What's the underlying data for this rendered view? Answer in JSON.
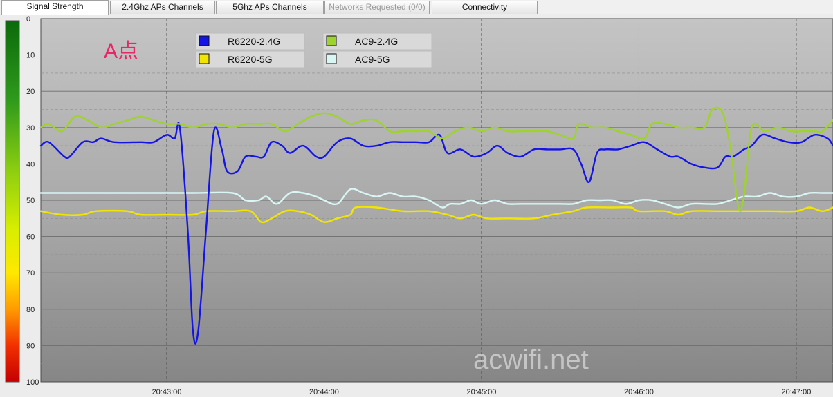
{
  "tabs": [
    {
      "label": "Signal Strength",
      "active": true,
      "enabled": true
    },
    {
      "label": "2.4Ghz APs Channels",
      "active": false,
      "enabled": true
    },
    {
      "label": "5Ghz APs Channels",
      "active": false,
      "enabled": true
    },
    {
      "label": "Networks Requested (0/0)",
      "active": false,
      "enabled": false
    },
    {
      "label": "Connectivity",
      "active": false,
      "enabled": true
    }
  ],
  "annotation": {
    "text": "A点",
    "color": "#e8266a"
  },
  "watermark": "acwifi.net",
  "chart_data": {
    "type": "line",
    "y_axis": {
      "range": [
        0,
        100
      ],
      "inverted": true,
      "ticks": [
        0,
        10,
        20,
        30,
        40,
        50,
        60,
        70,
        80,
        90,
        100
      ]
    },
    "x_axis": {
      "range": [
        "20:42:12",
        "20:47:14"
      ],
      "ticks": [
        "20:43:00",
        "20:44:00",
        "20:45:00",
        "20:46:00",
        "20:47:00"
      ]
    },
    "grid": true,
    "legend_placement": "top-left",
    "series": [
      {
        "name": "R6220-2.4G",
        "color": "#1414e6",
        "points": [
          [
            "20:42:12",
            35
          ],
          [
            "20:42:15",
            34
          ],
          [
            "20:42:21",
            38
          ],
          [
            "20:42:23",
            38
          ],
          [
            "20:42:28",
            34
          ],
          [
            "20:42:32",
            34
          ],
          [
            "20:42:35",
            33
          ],
          [
            "20:42:40",
            34
          ],
          [
            "20:42:50",
            34
          ],
          [
            "20:42:55",
            34
          ],
          [
            "20:43:00",
            32
          ],
          [
            "20:43:03",
            33
          ],
          [
            "20:43:05",
            30
          ],
          [
            "20:43:08",
            58
          ],
          [
            "20:43:10",
            86
          ],
          [
            "20:43:12",
            86
          ],
          [
            "20:43:15",
            58
          ],
          [
            "20:43:18",
            31
          ],
          [
            "20:43:21",
            36
          ],
          [
            "20:43:23",
            42
          ],
          [
            "20:43:27",
            42
          ],
          [
            "20:43:30",
            38
          ],
          [
            "20:43:34",
            38
          ],
          [
            "20:43:37",
            38
          ],
          [
            "20:43:40",
            34
          ],
          [
            "20:43:44",
            35
          ],
          [
            "20:43:47",
            37
          ],
          [
            "20:43:52",
            35
          ],
          [
            "20:43:57",
            38
          ],
          [
            "20:44:00",
            38
          ],
          [
            "20:44:05",
            34
          ],
          [
            "20:44:10",
            33
          ],
          [
            "20:44:15",
            35
          ],
          [
            "20:44:20",
            35
          ],
          [
            "20:44:25",
            34
          ],
          [
            "20:44:30",
            34
          ],
          [
            "20:44:35",
            34
          ],
          [
            "20:44:40",
            34
          ],
          [
            "20:44:44",
            32
          ],
          [
            "20:44:47",
            37
          ],
          [
            "20:44:52",
            36
          ],
          [
            "20:44:57",
            38
          ],
          [
            "20:45:02",
            37
          ],
          [
            "20:45:06",
            35
          ],
          [
            "20:45:10",
            37
          ],
          [
            "20:45:15",
            38
          ],
          [
            "20:45:20",
            36
          ],
          [
            "20:45:25",
            36
          ],
          [
            "20:45:30",
            36
          ],
          [
            "20:45:35",
            36
          ],
          [
            "20:45:38",
            40
          ],
          [
            "20:45:41",
            45
          ],
          [
            "20:45:44",
            37
          ],
          [
            "20:45:47",
            36
          ],
          [
            "20:45:52",
            36
          ],
          [
            "20:45:57",
            35
          ],
          [
            "20:46:02",
            34
          ],
          [
            "20:46:07",
            36
          ],
          [
            "20:46:12",
            38
          ],
          [
            "20:46:15",
            38
          ],
          [
            "20:46:20",
            40
          ],
          [
            "20:46:25",
            41
          ],
          [
            "20:46:30",
            41
          ],
          [
            "20:46:33",
            38
          ],
          [
            "20:46:36",
            38
          ],
          [
            "20:46:40",
            36
          ],
          [
            "20:46:43",
            35
          ],
          [
            "20:46:47",
            32
          ],
          [
            "20:46:52",
            33
          ],
          [
            "20:46:57",
            34
          ],
          [
            "20:47:02",
            34
          ],
          [
            "20:47:07",
            32
          ],
          [
            "20:47:12",
            33
          ],
          [
            "20:47:14",
            35
          ]
        ]
      },
      {
        "name": "R6220-5G",
        "color": "#f2e600",
        "points": [
          [
            "20:42:12",
            53
          ],
          [
            "20:42:20",
            54
          ],
          [
            "20:42:28",
            54
          ],
          [
            "20:42:33",
            53
          ],
          [
            "20:42:45",
            53
          ],
          [
            "20:42:50",
            54
          ],
          [
            "20:43:00",
            54
          ],
          [
            "20:43:10",
            54
          ],
          [
            "20:43:15",
            53
          ],
          [
            "20:43:25",
            53
          ],
          [
            "20:43:32",
            53
          ],
          [
            "20:43:36",
            56
          ],
          [
            "20:43:40",
            55
          ],
          [
            "20:43:45",
            53
          ],
          [
            "20:43:50",
            53
          ],
          [
            "20:43:55",
            54
          ],
          [
            "20:44:00",
            56
          ],
          [
            "20:44:05",
            55
          ],
          [
            "20:44:10",
            54
          ],
          [
            "20:44:12",
            52
          ],
          [
            "20:44:20",
            52
          ],
          [
            "20:44:30",
            53
          ],
          [
            "20:44:40",
            53
          ],
          [
            "20:44:47",
            54
          ],
          [
            "20:44:52",
            55
          ],
          [
            "20:44:57",
            54
          ],
          [
            "20:45:02",
            55
          ],
          [
            "20:45:10",
            55
          ],
          [
            "20:45:20",
            55
          ],
          [
            "20:45:27",
            54
          ],
          [
            "20:45:35",
            53
          ],
          [
            "20:45:40",
            52
          ],
          [
            "20:45:50",
            52
          ],
          [
            "20:45:57",
            52
          ],
          [
            "20:46:00",
            53
          ],
          [
            "20:46:10",
            53
          ],
          [
            "20:46:15",
            54
          ],
          [
            "20:46:20",
            53
          ],
          [
            "20:46:30",
            53
          ],
          [
            "20:46:40",
            53
          ],
          [
            "20:46:50",
            53
          ],
          [
            "20:47:00",
            53
          ],
          [
            "20:47:05",
            52
          ],
          [
            "20:47:10",
            53
          ],
          [
            "20:47:14",
            52
          ]
        ]
      },
      {
        "name": "AC9-2.4G",
        "color": "#9ed22c",
        "points": [
          [
            "20:42:12",
            30
          ],
          [
            "20:42:15",
            29
          ],
          [
            "20:42:20",
            31
          ],
          [
            "20:42:25",
            27
          ],
          [
            "20:42:30",
            28
          ],
          [
            "20:42:35",
            30
          ],
          [
            "20:42:40",
            29
          ],
          [
            "20:42:45",
            28
          ],
          [
            "20:42:50",
            27
          ],
          [
            "20:42:55",
            28
          ],
          [
            "20:43:00",
            29
          ],
          [
            "20:43:05",
            29
          ],
          [
            "20:43:10",
            30
          ],
          [
            "20:43:15",
            29
          ],
          [
            "20:43:20",
            29
          ],
          [
            "20:43:25",
            30
          ],
          [
            "20:43:30",
            29
          ],
          [
            "20:43:35",
            29
          ],
          [
            "20:43:40",
            29
          ],
          [
            "20:43:45",
            31
          ],
          [
            "20:43:50",
            29
          ],
          [
            "20:43:55",
            27
          ],
          [
            "20:44:00",
            26
          ],
          [
            "20:44:05",
            27
          ],
          [
            "20:44:10",
            29
          ],
          [
            "20:44:15",
            28
          ],
          [
            "20:44:20",
            28
          ],
          [
            "20:44:25",
            31
          ],
          [
            "20:44:30",
            31
          ],
          [
            "20:44:35",
            31
          ],
          [
            "20:44:40",
            31
          ],
          [
            "20:44:45",
            33
          ],
          [
            "20:44:50",
            31
          ],
          [
            "20:44:55",
            30
          ],
          [
            "20:45:00",
            31
          ],
          [
            "20:45:05",
            30
          ],
          [
            "20:45:10",
            31
          ],
          [
            "20:45:15",
            31
          ],
          [
            "20:45:20",
            31
          ],
          [
            "20:45:25",
            31
          ],
          [
            "20:45:30",
            32
          ],
          [
            "20:45:35",
            33
          ],
          [
            "20:45:37",
            29
          ],
          [
            "20:45:42",
            30
          ],
          [
            "20:45:47",
            30
          ],
          [
            "20:45:52",
            31
          ],
          [
            "20:45:57",
            32
          ],
          [
            "20:46:02",
            33
          ],
          [
            "20:46:05",
            29
          ],
          [
            "20:46:10",
            29
          ],
          [
            "20:46:15",
            30
          ],
          [
            "20:46:20",
            30
          ],
          [
            "20:46:25",
            30
          ],
          [
            "20:46:28",
            25
          ],
          [
            "20:46:32",
            26
          ],
          [
            "20:46:35",
            36
          ],
          [
            "20:46:38",
            52
          ],
          [
            "20:46:40",
            49
          ],
          [
            "20:46:43",
            30
          ],
          [
            "20:46:48",
            31
          ],
          [
            "20:46:53",
            30
          ],
          [
            "20:46:58",
            31
          ],
          [
            "20:47:03",
            31
          ],
          [
            "20:47:07",
            31
          ],
          [
            "20:47:10",
            31
          ],
          [
            "20:47:14",
            28
          ]
        ]
      },
      {
        "name": "AC9-5G",
        "color": "#d8f6f4",
        "points": [
          [
            "20:42:12",
            48
          ],
          [
            "20:42:30",
            48
          ],
          [
            "20:42:50",
            48
          ],
          [
            "20:43:10",
            48
          ],
          [
            "20:43:25",
            48
          ],
          [
            "20:43:30",
            50
          ],
          [
            "20:43:35",
            50
          ],
          [
            "20:43:38",
            49
          ],
          [
            "20:43:42",
            51
          ],
          [
            "20:43:47",
            48
          ],
          [
            "20:43:52",
            48
          ],
          [
            "20:43:57",
            49
          ],
          [
            "20:44:00",
            50
          ],
          [
            "20:44:05",
            51
          ],
          [
            "20:44:10",
            47
          ],
          [
            "20:44:15",
            48
          ],
          [
            "20:44:20",
            49
          ],
          [
            "20:44:25",
            48
          ],
          [
            "20:44:30",
            49
          ],
          [
            "20:44:35",
            49
          ],
          [
            "20:44:40",
            50
          ],
          [
            "20:44:45",
            52
          ],
          [
            "20:44:48",
            51
          ],
          [
            "20:44:52",
            51
          ],
          [
            "20:44:56",
            50
          ],
          [
            "20:45:00",
            51
          ],
          [
            "20:45:05",
            50
          ],
          [
            "20:45:10",
            51
          ],
          [
            "20:45:15",
            51
          ],
          [
            "20:45:20",
            51
          ],
          [
            "20:45:25",
            51
          ],
          [
            "20:45:30",
            51
          ],
          [
            "20:45:35",
            51
          ],
          [
            "20:45:40",
            50
          ],
          [
            "20:45:45",
            50
          ],
          [
            "20:45:50",
            50
          ],
          [
            "20:45:55",
            51
          ],
          [
            "20:46:00",
            50
          ],
          [
            "20:46:05",
            50
          ],
          [
            "20:46:10",
            51
          ],
          [
            "20:46:15",
            52
          ],
          [
            "20:46:20",
            51
          ],
          [
            "20:46:25",
            51
          ],
          [
            "20:46:30",
            51
          ],
          [
            "20:46:35",
            50
          ],
          [
            "20:46:40",
            49
          ],
          [
            "20:46:45",
            49
          ],
          [
            "20:46:50",
            48
          ],
          [
            "20:46:55",
            49
          ],
          [
            "20:47:00",
            49
          ],
          [
            "20:47:05",
            48
          ],
          [
            "20:47:10",
            48
          ],
          [
            "20:47:14",
            48
          ]
        ]
      }
    ]
  }
}
